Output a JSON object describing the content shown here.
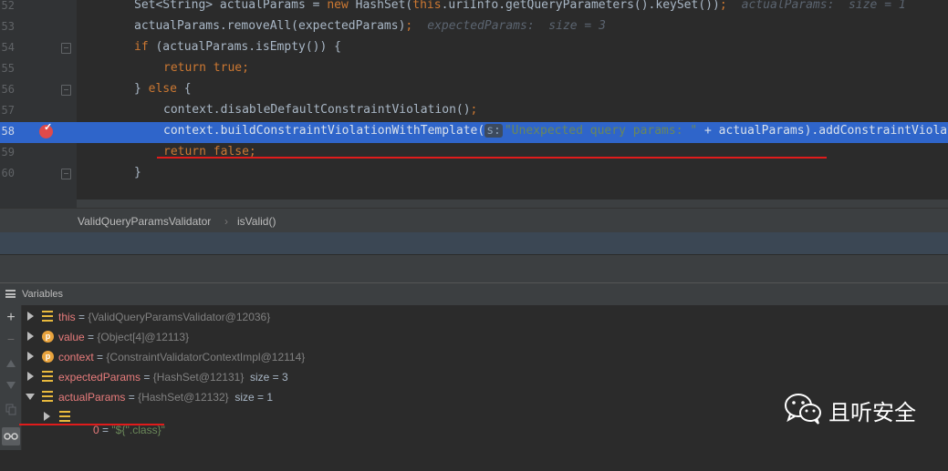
{
  "editor": {
    "lines": [
      {
        "num": "52",
        "indent": 1,
        "tokens": [
          {
            "t": "Set<String> actualParams = ",
            "c": "plain"
          },
          {
            "t": "new ",
            "c": "kw"
          },
          {
            "t": "HashSet(",
            "c": "plain"
          },
          {
            "t": "this",
            "c": "kw"
          },
          {
            "t": ".uriInfo.getQueryParameters().keySet())",
            "c": "plain"
          },
          {
            "t": ";",
            "c": "kw"
          }
        ],
        "hint": "actualParams:  size = 1"
      },
      {
        "num": "53",
        "indent": 1,
        "tokens": [
          {
            "t": "actualParams.removeAll(expectedParams)",
            "c": "plain"
          },
          {
            "t": ";",
            "c": "kw"
          }
        ],
        "hint": "expectedParams:  size = 3"
      },
      {
        "num": "54",
        "indent": 1,
        "tokens": [
          {
            "t": "if ",
            "c": "kw"
          },
          {
            "t": "(actualParams.isEmpty()) {",
            "c": "plain"
          }
        ]
      },
      {
        "num": "55",
        "indent": 2,
        "tokens": [
          {
            "t": "return true",
            "c": "kw"
          },
          {
            "t": ";",
            "c": "kw"
          }
        ]
      },
      {
        "num": "56",
        "indent": 1,
        "tokens": [
          {
            "t": "} ",
            "c": "plain"
          },
          {
            "t": "else ",
            "c": "kw"
          },
          {
            "t": "{",
            "c": "plain"
          }
        ]
      },
      {
        "num": "57",
        "indent": 2,
        "tokens": [
          {
            "t": "context.disableDefaultConstraintViolation()",
            "c": "plain"
          },
          {
            "t": ";",
            "c": "kw"
          }
        ]
      },
      {
        "num": "58",
        "indent": 2,
        "highlighted": true,
        "tokens": [
          {
            "t": "context.buildConstraintViolationWithTemplate(",
            "c": "plain"
          },
          {
            "t": "s:",
            "c": "hintbox"
          },
          {
            "t": "\"Unexpected query params: \"",
            "c": "str"
          },
          {
            "t": " + actualParams).addConstraintViolation()",
            "c": "plain"
          }
        ]
      },
      {
        "num": "59",
        "indent": 2,
        "tokens": [
          {
            "t": "return false",
            "c": "kw"
          },
          {
            "t": ";",
            "c": "kw"
          }
        ]
      },
      {
        "num": "60",
        "indent": 1,
        "tokens": [
          {
            "t": "}",
            "c": "plain"
          }
        ]
      }
    ]
  },
  "breadcrumb": {
    "class_name": "ValidQueryParamsValidator",
    "separator": "›",
    "method": "isValid()"
  },
  "variables": {
    "title": "Variables",
    "toolbar": {
      "add": "+",
      "remove": "−"
    },
    "rows": [
      {
        "icon": "list-icon",
        "name": "this",
        "eq": " = ",
        "value": "{ValidQueryParamsValidator@12036}",
        "size": "",
        "expanded": false
      },
      {
        "icon": "p-icon",
        "name": "value",
        "eq": " = ",
        "value": "{Object[4]@12113}",
        "size": "",
        "expanded": false
      },
      {
        "icon": "p-icon",
        "name": "context",
        "eq": " = ",
        "value": "{ConstraintValidatorContextImpl@12114}",
        "size": "",
        "expanded": false
      },
      {
        "icon": "list-icon",
        "name": "expectedParams",
        "eq": " = ",
        "value": "{HashSet@12131}",
        "size": "size = 3",
        "expanded": false
      },
      {
        "icon": "list-icon",
        "name": "actualParams",
        "eq": " = ",
        "value": "{HashSet@12132}",
        "size": "size = 1",
        "expanded": true
      }
    ],
    "child_row": {
      "name": "0",
      "eq": " = ",
      "value": "\"${''.class}\""
    }
  },
  "watermark": {
    "text": "且听安全"
  },
  "colors": {
    "highlight_line": "#2f65ca",
    "breakpoint": "#e04a4a",
    "annotation_underline": "#e01b1b"
  }
}
